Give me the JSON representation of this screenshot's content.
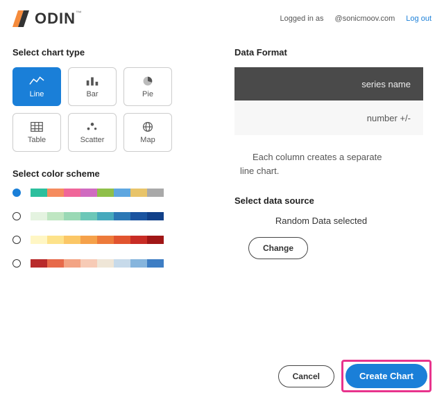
{
  "brand": {
    "name": "ODIN",
    "tm": "™"
  },
  "userbar": {
    "logged_in": "Logged in as",
    "handle": "@sonicmoov.com",
    "logout": "Log out"
  },
  "sections": {
    "chart_type": "Select chart type",
    "color_scheme": "Select color scheme",
    "data_format": "Data Format",
    "data_source": "Select data source"
  },
  "chart_types": {
    "line": "Line",
    "bar": "Bar",
    "pie": "Pie",
    "table": "Table",
    "scatter": "Scatter",
    "map": "Map"
  },
  "color_schemes": [
    [
      "#2cbf9d",
      "#f58b5e",
      "#f06699",
      "#d06bc0",
      "#8fbf4a",
      "#5fa7e0",
      "#e8c46a",
      "#a9a9a9"
    ],
    [
      "#e4f3e0",
      "#bfe6c2",
      "#9ad9b5",
      "#6cc7b8",
      "#46a9bd",
      "#2c78b5",
      "#1b54a0",
      "#114089"
    ],
    [
      "#fff6c4",
      "#fde28a",
      "#fbc766",
      "#f5a14a",
      "#ed7a3a",
      "#e1542f",
      "#c82c25",
      "#a01616"
    ],
    [
      "#b82b2b",
      "#e76a4a",
      "#f3a484",
      "#f7cbb6",
      "#efe6d7",
      "#c7daea",
      "#86b5dd",
      "#3e7ec4"
    ]
  ],
  "format": {
    "header": "series name",
    "row": "number +/-",
    "description_1": "Each column creates a separate",
    "description_2": "line chart."
  },
  "source": {
    "selected_text": "Random Data selected",
    "change": "Change"
  },
  "actions": {
    "cancel": "Cancel",
    "create": "Create Chart"
  }
}
